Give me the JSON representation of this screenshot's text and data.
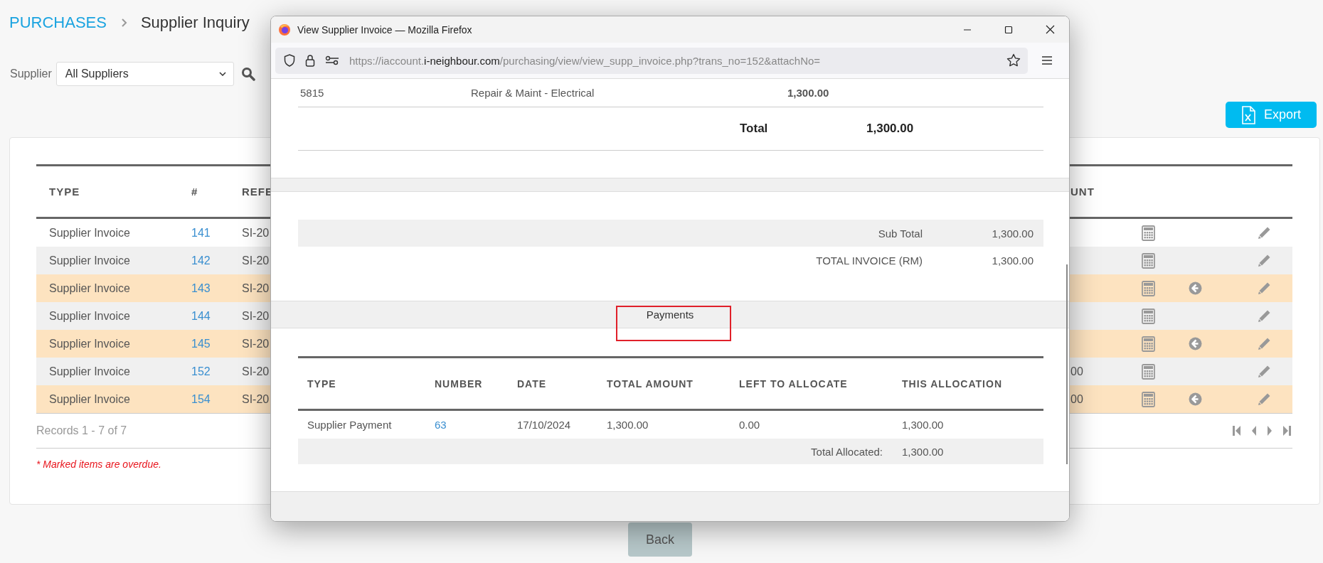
{
  "breadcrumb": {
    "section": "PURCHASES",
    "page": "Supplier Inquiry"
  },
  "filter": {
    "label": "Supplier",
    "value": "All Suppliers"
  },
  "export_button": "Export",
  "table": {
    "columns": [
      "TYPE",
      "#",
      "REFE",
      "UNT"
    ],
    "rows": [
      {
        "type": "Supplier Invoice",
        "number": "141",
        "reference": "SI-20",
        "overdue": false,
        "payment_icon": false
      },
      {
        "type": "Supplier Invoice",
        "number": "142",
        "reference": "SI-20",
        "overdue": false,
        "payment_icon": false
      },
      {
        "type": "Supplier Invoice",
        "number": "143",
        "reference": "SI-20",
        "overdue": true,
        "payment_icon": true
      },
      {
        "type": "Supplier Invoice",
        "number": "144",
        "reference": "SI-20",
        "overdue": false,
        "payment_icon": false
      },
      {
        "type": "Supplier Invoice",
        "number": "145",
        "reference": "SI-20",
        "overdue": true,
        "payment_icon": true
      },
      {
        "type": "Supplier Invoice",
        "number": "152",
        "reference": "SI-20",
        "amount": "00",
        "overdue": false,
        "payment_icon": false
      },
      {
        "type": "Supplier Invoice",
        "number": "154",
        "reference": "SI-20",
        "amount": "00",
        "overdue": true,
        "payment_icon": true
      }
    ],
    "records": "Records 1 - 7 of 7"
  },
  "note": "* Marked items are overdue.",
  "back_button": "Back",
  "popup": {
    "title": "View Supplier Invoice — Mozilla Firefox",
    "url": {
      "scheme": "https://iaccount.",
      "domain": "i-neighbour.com",
      "path": "/purchasing/view/view_supp_invoice.php?trans_no=152&attachNo="
    },
    "lines": [
      {
        "account": "5815",
        "description": "Repair & Maint - Electrical",
        "amount": "1,300.00"
      }
    ],
    "total": {
      "label": "Total",
      "value": "1,300.00"
    },
    "summary": [
      {
        "label": "Sub Total",
        "value": "1,300.00",
        "shaded": true
      },
      {
        "label": "TOTAL INVOICE (RM)",
        "value": "1,300.00",
        "shaded": false
      }
    ],
    "section": "Payments",
    "payments": {
      "columns": [
        "TYPE",
        "NUMBER",
        "DATE",
        "TOTAL AMOUNT",
        "LEFT TO ALLOCATE",
        "THIS ALLOCATION"
      ],
      "rows": [
        {
          "type": "Supplier Payment",
          "number": "63",
          "date": "17/10/2024",
          "total_amount": "1,300.00",
          "left_to_allocate": "0.00",
          "this_allocation": "1,300.00"
        }
      ],
      "total": {
        "label": "Total Allocated:",
        "value": "1,300.00"
      }
    }
  }
}
